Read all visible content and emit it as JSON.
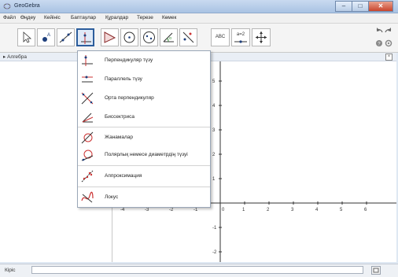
{
  "window": {
    "title": "GeoGebra",
    "controls": [
      "–",
      "□",
      "✕"
    ]
  },
  "menu": [
    "Файл",
    "Өңдеу",
    "Кейініс",
    "Баптаулар",
    "Құралдар",
    "Терезе",
    "Көмек"
  ],
  "toolbar": {
    "tools": [
      {
        "name": "move-tool",
        "label": ""
      },
      {
        "name": "point-tool",
        "label": ""
      },
      {
        "name": "line-tool",
        "label": ""
      },
      {
        "name": "perpendicular-line-tool",
        "label": "",
        "active": true
      },
      {
        "name": "polygon-tool",
        "label": ""
      },
      {
        "name": "circle-tool",
        "label": ""
      },
      {
        "name": "ellipse-tool",
        "label": ""
      },
      {
        "name": "angle-tool",
        "label": ""
      },
      {
        "name": "reflect-tool",
        "label": ""
      },
      {
        "name": "text-tool",
        "label": "ABC"
      },
      {
        "name": "slider-tool",
        "label": "a=2"
      },
      {
        "name": "move-graphics-tool",
        "label": ""
      }
    ]
  },
  "algebra": {
    "header": "Алгебра"
  },
  "dropdown": {
    "items": [
      {
        "name": "perpendicular",
        "label": "Перпендикуляр түзу"
      },
      {
        "name": "parallel",
        "label": "Параллель түзу"
      },
      {
        "name": "perpendicular-bisector",
        "label": "Орта перпендикуляр"
      },
      {
        "name": "angle-bisector",
        "label": "Биссектриса"
      },
      {
        "name": "tangents",
        "label": "Жанамалар"
      },
      {
        "name": "polar-line",
        "label": "Полярлық немесе диаметрдің түзуі"
      },
      {
        "name": "best-fit-line",
        "label": "Аппроксимация"
      },
      {
        "name": "locus",
        "label": "Локус"
      }
    ]
  },
  "graphics": {
    "x_ticks": [
      "-4",
      "-3",
      "-2",
      "-1",
      "0",
      "1",
      "2",
      "3",
      "4",
      "5",
      "6"
    ],
    "y_ticks": [
      "6",
      "5",
      "4",
      "3",
      "2",
      "1",
      "0",
      "-1",
      "-2"
    ]
  },
  "input": {
    "label": "Кіріс",
    "value": ""
  },
  "colors": {
    "active_border": "#2c5d9c",
    "axis": "#333333"
  }
}
